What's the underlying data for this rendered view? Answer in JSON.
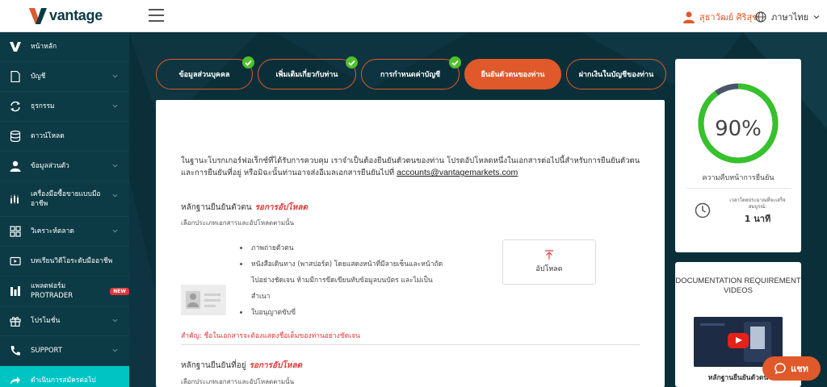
{
  "header": {
    "brand": "vantage",
    "user_name": "สุธาวัฒย์ ศิริสุข",
    "language": "ภาษาไทย"
  },
  "sidebar": {
    "items": [
      {
        "label": "หน้าหลัก",
        "icon": "v-logo-icon",
        "chevron": false
      },
      {
        "label": "บัญชี",
        "icon": "document-icon",
        "chevron": true
      },
      {
        "label": "ธุรกรรม",
        "icon": "sync-icon",
        "chevron": true
      },
      {
        "label": "ดาวน์โหลด",
        "icon": "database-icon",
        "chevron": false
      },
      {
        "label": "ข้อมูลส่วนตัว",
        "icon": "user-icon",
        "chevron": true
      },
      {
        "label": "เครื่องมือซื้อขายแบบมืออาชีพ",
        "icon": "chart-icon",
        "chevron": true
      },
      {
        "label": "วิเคราะห์ตลาด",
        "icon": "grid-icon",
        "chevron": true
      },
      {
        "label": "บทเรียนวิดีโอระดับมืออาชีพ",
        "icon": "video-icon",
        "chevron": false
      },
      {
        "label": "แพลตฟอร์ม PROTRADER",
        "icon": "protrader-icon",
        "chevron": false,
        "badge": "NEW"
      },
      {
        "label": "โปรโมชั่น",
        "icon": "gift-icon",
        "chevron": true
      },
      {
        "label": "SUPPORT",
        "icon": "phone-icon",
        "chevron": true
      },
      {
        "label": "ดำเนินการสมัครต่อไป",
        "icon": "continue-icon",
        "chevron": false,
        "active": true
      }
    ]
  },
  "steps": [
    {
      "label": "ข้อมูลส่วนบุคคล",
      "completed": true
    },
    {
      "label": "เพิ่มเติมเกี่ยวกับท่าน",
      "completed": true
    },
    {
      "label": "การกำหนดค่าบัญชี",
      "completed": true
    },
    {
      "label": "ยืนยันตัวตนของท่าน",
      "active": true
    },
    {
      "label": "ฝากเงินในบัญชีของท่าน"
    }
  ],
  "verification": {
    "intro": "ในฐานะโบรกเกอร์ฟอเร็กซ์ที่ได้รับการควบคุม เราจำเป็นต้องยืนยันตัวตนของท่าน โปรดอัปโหลดหนึ่งในเอกสารต่อไปนี้สำหรับการยืนยันตัวตนและการยืนยันที่อยู่ หรือมิฉะนั้นท่านอาจส่งอีเมลเอกสารยืนยันไปที่",
    "email": "accounts@vantagemarkets.com",
    "identity": {
      "title": "หลักฐานยืนยันตัวตน",
      "status": "รอการอัปโหลด",
      "subtitle": "เลือกประเภทเอกสารและอัปโหลดตามนั้น",
      "documents": [
        "ภาพถ่ายตัวตน",
        "หนังสือเดินทาง (พาสปอร์ต) โดยแสดงหน้าที่มีลายเซ็นและหน้าถัดไปอย่างชัดเจน ห้ามมีการขีดเขียนทับข้อมูลบนบัตร และไม่เป็นสำเนา",
        "ใบอนุญาตขับขี่"
      ],
      "upload_label": "อัปโหลด",
      "important": "สำคัญ: ชื่อในเอกสารจะต้องแสดงชื่อเต็มของท่านอย่างชัดเจน"
    },
    "address": {
      "title": "หลักฐานยืนยันที่อยู่",
      "status": "รอการอัปโหลด",
      "subtitle": "เลือกประเภทเอกสารและอัปโหลดตามนั้น"
    }
  },
  "progress": {
    "percent_label": "90%",
    "percent": 90,
    "caption": "ความคืบหน้าการยืนยัน",
    "time_caption": "เวลาโดยประมาณที่จะเสร็จสมบูรณ์:",
    "time_value": "1 นาที"
  },
  "videos": {
    "title": "DOCUMENTATION REQUIREMENT VIDEOS",
    "caption": "หลักฐานยืนยันตัวตน"
  },
  "chat": {
    "label": "แชท"
  },
  "colors": {
    "accent": "#e0592a",
    "sidebar": "#0c3a45",
    "active": "#00c3c3",
    "success": "#4ec22a",
    "alert": "#e0373a"
  }
}
